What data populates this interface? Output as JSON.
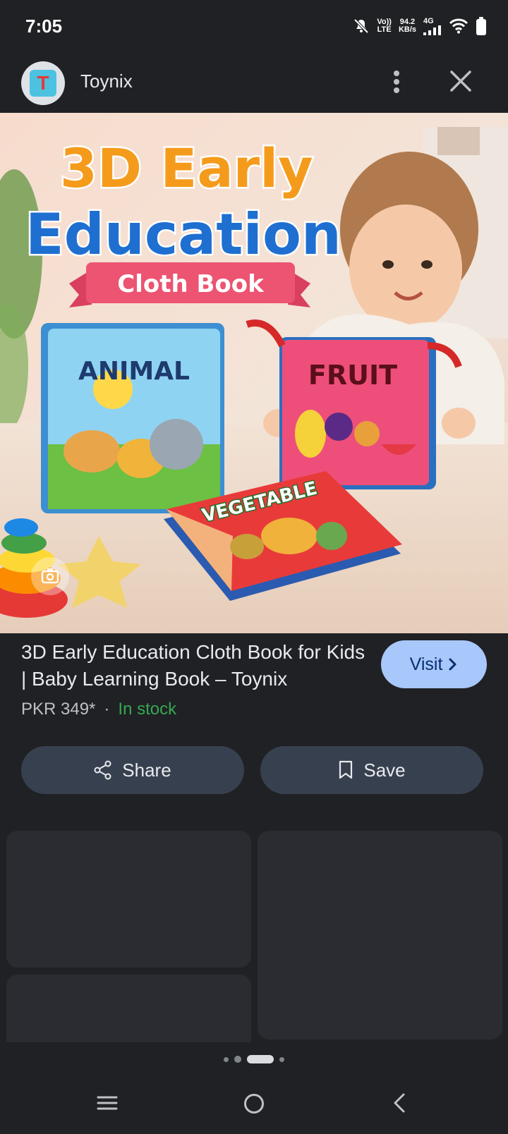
{
  "status_bar": {
    "time": "7:05",
    "volte_top": "Vo))",
    "volte_bottom": "LTE",
    "speed_top": "94.2",
    "speed_bottom": "KB/s",
    "network": "4G"
  },
  "header": {
    "avatar_letter": "T",
    "title": "Toynix"
  },
  "hero": {
    "headline_1": "3D Early",
    "headline_2": "Education",
    "banner": "Cloth Book",
    "book_animal": "ANIMAL",
    "book_fruit": "FRUIT",
    "book_vegetable": "VEGETABLE"
  },
  "product": {
    "title": "3D Early Education Cloth Book for Kids | Baby Learning Book – Toynix",
    "price": "PKR 349*",
    "separator": "·",
    "stock": "In stock",
    "visit_label": "Visit"
  },
  "actions": {
    "share_label": "Share",
    "save_label": "Save"
  },
  "colors": {
    "background": "#202124",
    "visit_button": "#a8c7fa",
    "action_button": "#37404f",
    "in_stock": "#34a853"
  },
  "icons": [
    "mute-icon",
    "signal-icon",
    "wifi-icon",
    "battery-icon",
    "more-vert-icon",
    "close-icon",
    "lens-icon",
    "chevron-right-icon",
    "share-icon",
    "bookmark-icon",
    "menu-icon",
    "home-icon",
    "back-icon"
  ]
}
